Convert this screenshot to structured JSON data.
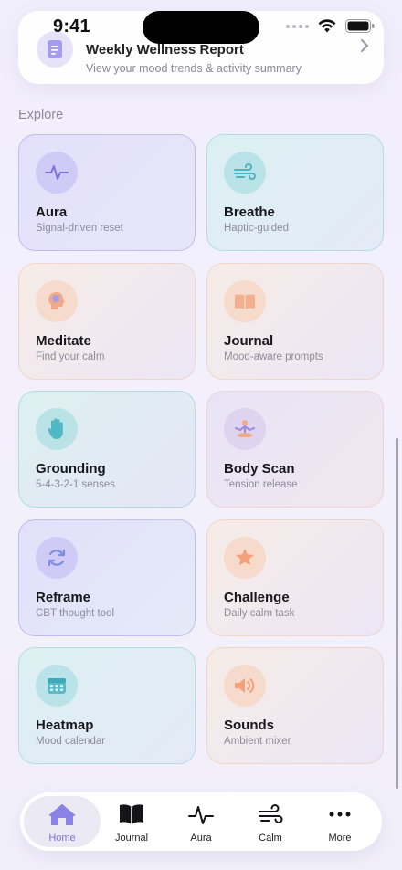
{
  "status_bar": {
    "time": "9:41"
  },
  "report": {
    "title": "Weekly Wellness Report",
    "subtitle": "View your mood trends & activity summary"
  },
  "section_title": "Explore",
  "tiles": [
    {
      "title": "Aura",
      "subtitle": "Signal-driven reset",
      "icon": "pulse-icon"
    },
    {
      "title": "Breathe",
      "subtitle": "Haptic-guided",
      "icon": "wind-icon"
    },
    {
      "title": "Meditate",
      "subtitle": "Find your calm",
      "icon": "brain-icon"
    },
    {
      "title": "Journal",
      "subtitle": "Mood-aware prompts",
      "icon": "book-icon"
    },
    {
      "title": "Grounding",
      "subtitle": "5-4-3-2-1 senses",
      "icon": "hand-icon"
    },
    {
      "title": "Body Scan",
      "subtitle": "Tension release",
      "icon": "meditation-figure-icon"
    },
    {
      "title": "Reframe",
      "subtitle": "CBT thought tool",
      "icon": "refresh-icon"
    },
    {
      "title": "Challenge",
      "subtitle": "Daily calm task",
      "icon": "star-icon"
    },
    {
      "title": "Heatmap",
      "subtitle": "Mood calendar",
      "icon": "calendar-icon"
    },
    {
      "title": "Sounds",
      "subtitle": "Ambient mixer",
      "icon": "speaker-icon"
    }
  ],
  "tab_bar": {
    "items": [
      {
        "label": "Home",
        "icon": "home-icon",
        "active": true
      },
      {
        "label": "Journal",
        "icon": "book-icon",
        "active": false
      },
      {
        "label": "Aura",
        "icon": "pulse-icon",
        "active": false
      },
      {
        "label": "Calm",
        "icon": "wind-icon",
        "active": false
      },
      {
        "label": "More",
        "icon": "more-icon",
        "active": false
      }
    ]
  },
  "colors": {
    "accent": "#7b73dd",
    "background": "#f1eefb",
    "tile_purple": "#e4e0fa",
    "tile_teal": "#dcf0f2",
    "tile_peach": "#f6ece6"
  }
}
